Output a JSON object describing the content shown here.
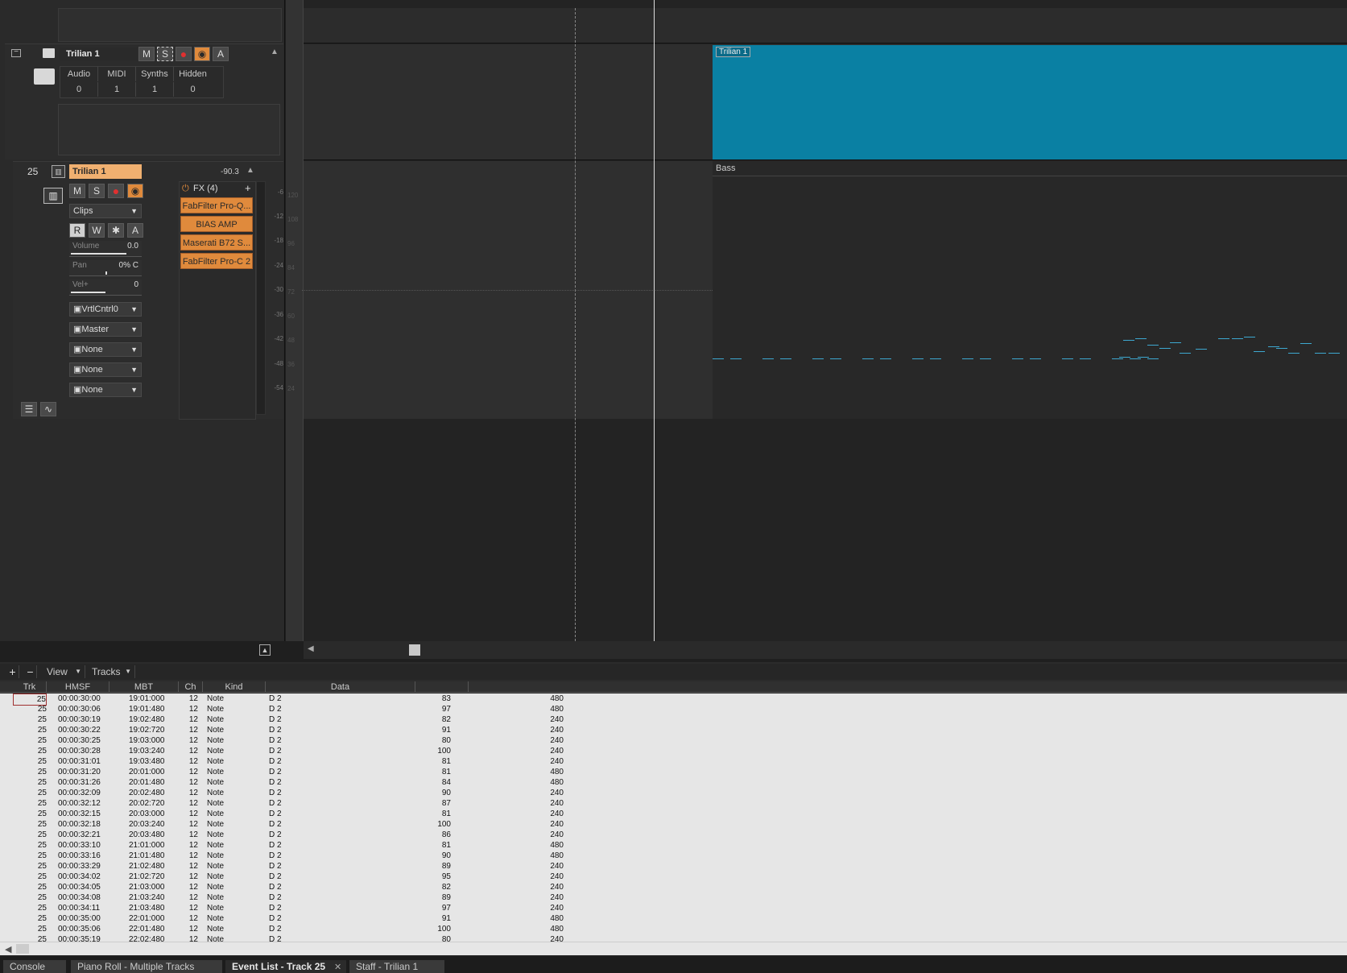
{
  "folder_track": {
    "name": "Trilian 1",
    "buttons": {
      "mute": "M",
      "solo": "S",
      "auto": "A"
    },
    "stats_headers": [
      "Audio",
      "MIDI",
      "Synths",
      "Hidden"
    ],
    "stats_values": [
      "0",
      "1",
      "1",
      "0"
    ]
  },
  "instrument_track": {
    "number": "25",
    "name": "Trilian 1",
    "peak": "-90.3",
    "buttons": {
      "mute": "M",
      "solo": "S",
      "read": "R",
      "write": "W",
      "auto": "A"
    },
    "clips_label": "Clips",
    "volume": {
      "label": "Volume",
      "value": "0.0",
      "level": 0.8
    },
    "pan": {
      "label": "Pan",
      "value": "0% C",
      "level": 0.5
    },
    "vel": {
      "label": "Vel+",
      "value": "0",
      "level": 0.5
    },
    "input": "VrtlCntrl0",
    "output": "Master",
    "sends": [
      "None",
      "None",
      "None"
    ],
    "fx_header": "FX (4)",
    "fx": [
      "FabFilter Pro-Q...",
      "BIAS AMP",
      "Maserati B72 S...",
      "FabFilter Pro-C 2"
    ],
    "meter_scale": [
      "-6",
      "-12",
      "-18",
      "-24",
      "-30",
      "-36",
      "-42",
      "-48",
      "-54"
    ],
    "pitch_scale": [
      "120",
      "108",
      "96",
      "84",
      "72",
      "60",
      "48",
      "36",
      "24"
    ]
  },
  "clips": {
    "folder_clip_label": "Trilian 1",
    "folder_clip_color": "#0a80a3",
    "bass_clip_label": "Bass",
    "note_color": "#3da8d0"
  },
  "event_list": {
    "toolbar": {
      "add": "+",
      "remove": "−",
      "view": "View",
      "tracks": "Tracks"
    },
    "columns": [
      "Trk",
      "HMSF",
      "MBT",
      "Ch",
      "Kind",
      "Data"
    ],
    "rows": [
      [
        "25",
        "00:00:30:00",
        "19:01:000",
        "12",
        "Note",
        "D 2",
        "83",
        "480"
      ],
      [
        "25",
        "00:00:30:06",
        "19:01:480",
        "12",
        "Note",
        "D 2",
        "97",
        "480"
      ],
      [
        "25",
        "00:00:30:19",
        "19:02:480",
        "12",
        "Note",
        "D 2",
        "82",
        "240"
      ],
      [
        "25",
        "00:00:30:22",
        "19:02:720",
        "12",
        "Note",
        "D 2",
        "91",
        "240"
      ],
      [
        "25",
        "00:00:30:25",
        "19:03:000",
        "12",
        "Note",
        "D 2",
        "80",
        "240"
      ],
      [
        "25",
        "00:00:30:28",
        "19:03:240",
        "12",
        "Note",
        "D 2",
        "100",
        "240"
      ],
      [
        "25",
        "00:00:31:01",
        "19:03:480",
        "12",
        "Note",
        "D 2",
        "81",
        "240"
      ],
      [
        "25",
        "00:00:31:20",
        "20:01:000",
        "12",
        "Note",
        "D 2",
        "81",
        "480"
      ],
      [
        "25",
        "00:00:31:26",
        "20:01:480",
        "12",
        "Note",
        "D 2",
        "84",
        "480"
      ],
      [
        "25",
        "00:00:32:09",
        "20:02:480",
        "12",
        "Note",
        "D 2",
        "90",
        "240"
      ],
      [
        "25",
        "00:00:32:12",
        "20:02:720",
        "12",
        "Note",
        "D 2",
        "87",
        "240"
      ],
      [
        "25",
        "00:00:32:15",
        "20:03:000",
        "12",
        "Note",
        "D 2",
        "81",
        "240"
      ],
      [
        "25",
        "00:00:32:18",
        "20:03:240",
        "12",
        "Note",
        "D 2",
        "100",
        "240"
      ],
      [
        "25",
        "00:00:32:21",
        "20:03:480",
        "12",
        "Note",
        "D 2",
        "86",
        "240"
      ],
      [
        "25",
        "00:00:33:10",
        "21:01:000",
        "12",
        "Note",
        "D 2",
        "81",
        "480"
      ],
      [
        "25",
        "00:00:33:16",
        "21:01:480",
        "12",
        "Note",
        "D 2",
        "90",
        "480"
      ],
      [
        "25",
        "00:00:33:29",
        "21:02:480",
        "12",
        "Note",
        "D 2",
        "89",
        "240"
      ],
      [
        "25",
        "00:00:34:02",
        "21:02:720",
        "12",
        "Note",
        "D 2",
        "95",
        "240"
      ],
      [
        "25",
        "00:00:34:05",
        "21:03:000",
        "12",
        "Note",
        "D 2",
        "82",
        "240"
      ],
      [
        "25",
        "00:00:34:08",
        "21:03:240",
        "12",
        "Note",
        "D 2",
        "89",
        "240"
      ],
      [
        "25",
        "00:00:34:11",
        "21:03:480",
        "12",
        "Note",
        "D 2",
        "97",
        "240"
      ],
      [
        "25",
        "00:00:35:00",
        "22:01:000",
        "12",
        "Note",
        "D 2",
        "91",
        "480"
      ],
      [
        "25",
        "00:00:35:06",
        "22:01:480",
        "12",
        "Note",
        "D 2",
        "100",
        "480"
      ],
      [
        "25",
        "00:00:35:19",
        "22:02:480",
        "12",
        "Note",
        "D 2",
        "80",
        "240"
      ]
    ]
  },
  "tabs": [
    {
      "label": "Console",
      "active": false
    },
    {
      "label": "Piano Roll - Multiple Tracks",
      "active": false
    },
    {
      "label": "Event List - Track 25",
      "active": true
    },
    {
      "label": "Staff - Trilian 1",
      "active": false
    }
  ]
}
